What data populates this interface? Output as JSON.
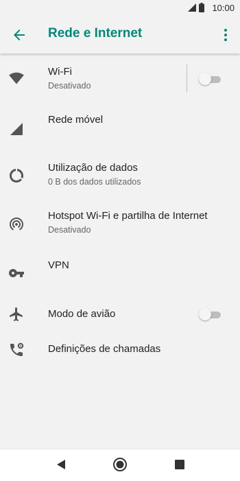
{
  "status_bar": {
    "time": "10:00"
  },
  "app_bar": {
    "title": "Rede e Internet"
  },
  "settings": {
    "wifi": {
      "title": "Wi-Fi",
      "subtitle": "Desativado",
      "enabled": false
    },
    "mobile_network": {
      "title": "Rede móvel"
    },
    "data_usage": {
      "title": "Utilização de dados",
      "subtitle": "0 B dos dados utilizados"
    },
    "hotspot": {
      "title": "Hotspot Wi-Fi e partilha de Internet",
      "subtitle": "Desativado"
    },
    "vpn": {
      "title": "VPN"
    },
    "airplane_mode": {
      "title": "Modo de avião",
      "enabled": false
    },
    "call_settings": {
      "title": "Definições de chamadas"
    }
  },
  "colors": {
    "accent": "#00897b",
    "icon": "#555555",
    "background": "#f2f2f2"
  }
}
